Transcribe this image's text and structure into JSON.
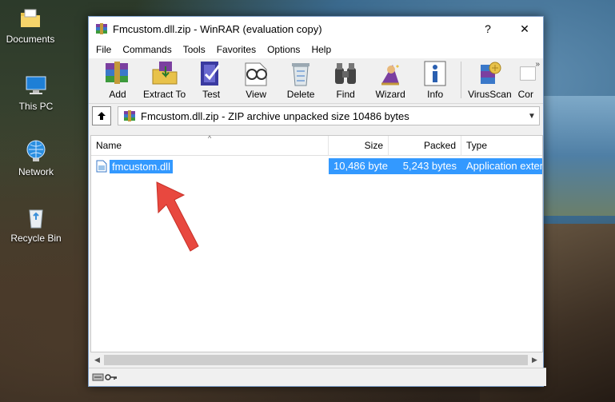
{
  "desktop": {
    "icons": [
      {
        "label": "Documents",
        "icon": "folder-icon"
      },
      {
        "label": "This PC",
        "icon": "computer-icon"
      },
      {
        "label": "Network",
        "icon": "network-icon"
      },
      {
        "label": "Recycle Bin",
        "icon": "recycle-bin-icon"
      }
    ]
  },
  "window": {
    "title": "Fmcustom.dll.zip - WinRAR (evaluation copy)",
    "help_label": "?",
    "close_label": "✕"
  },
  "menu": [
    "File",
    "Commands",
    "Tools",
    "Favorites",
    "Options",
    "Help"
  ],
  "toolbar": {
    "buttons": [
      {
        "label": "Add",
        "icon": "add-archive-icon"
      },
      {
        "label": "Extract To",
        "icon": "extract-to-icon"
      },
      {
        "label": "Test",
        "icon": "test-icon"
      },
      {
        "label": "View",
        "icon": "view-icon"
      },
      {
        "label": "Delete",
        "icon": "delete-icon"
      },
      {
        "label": "Find",
        "icon": "find-icon"
      },
      {
        "label": "Wizard",
        "icon": "wizard-icon"
      },
      {
        "label": "Info",
        "icon": "info-icon"
      },
      {
        "label": "VirusScan",
        "icon": "virusscan-icon"
      },
      {
        "label": "Cor",
        "icon": "comment-icon"
      }
    ],
    "overflow": "»"
  },
  "address": {
    "text": "Fmcustom.dll.zip - ZIP archive unpacked size 10486 bytes"
  },
  "columns": {
    "name": "Name",
    "size": "Size",
    "packed": "Packed",
    "type": "Type"
  },
  "files": [
    {
      "name": "fmcustom.dll",
      "size": "10,486 byte",
      "packed": "5,243 bytes",
      "type": "Application exter"
    }
  ],
  "colors": {
    "selection": "#3399ff",
    "arrow": "#e8483f"
  }
}
